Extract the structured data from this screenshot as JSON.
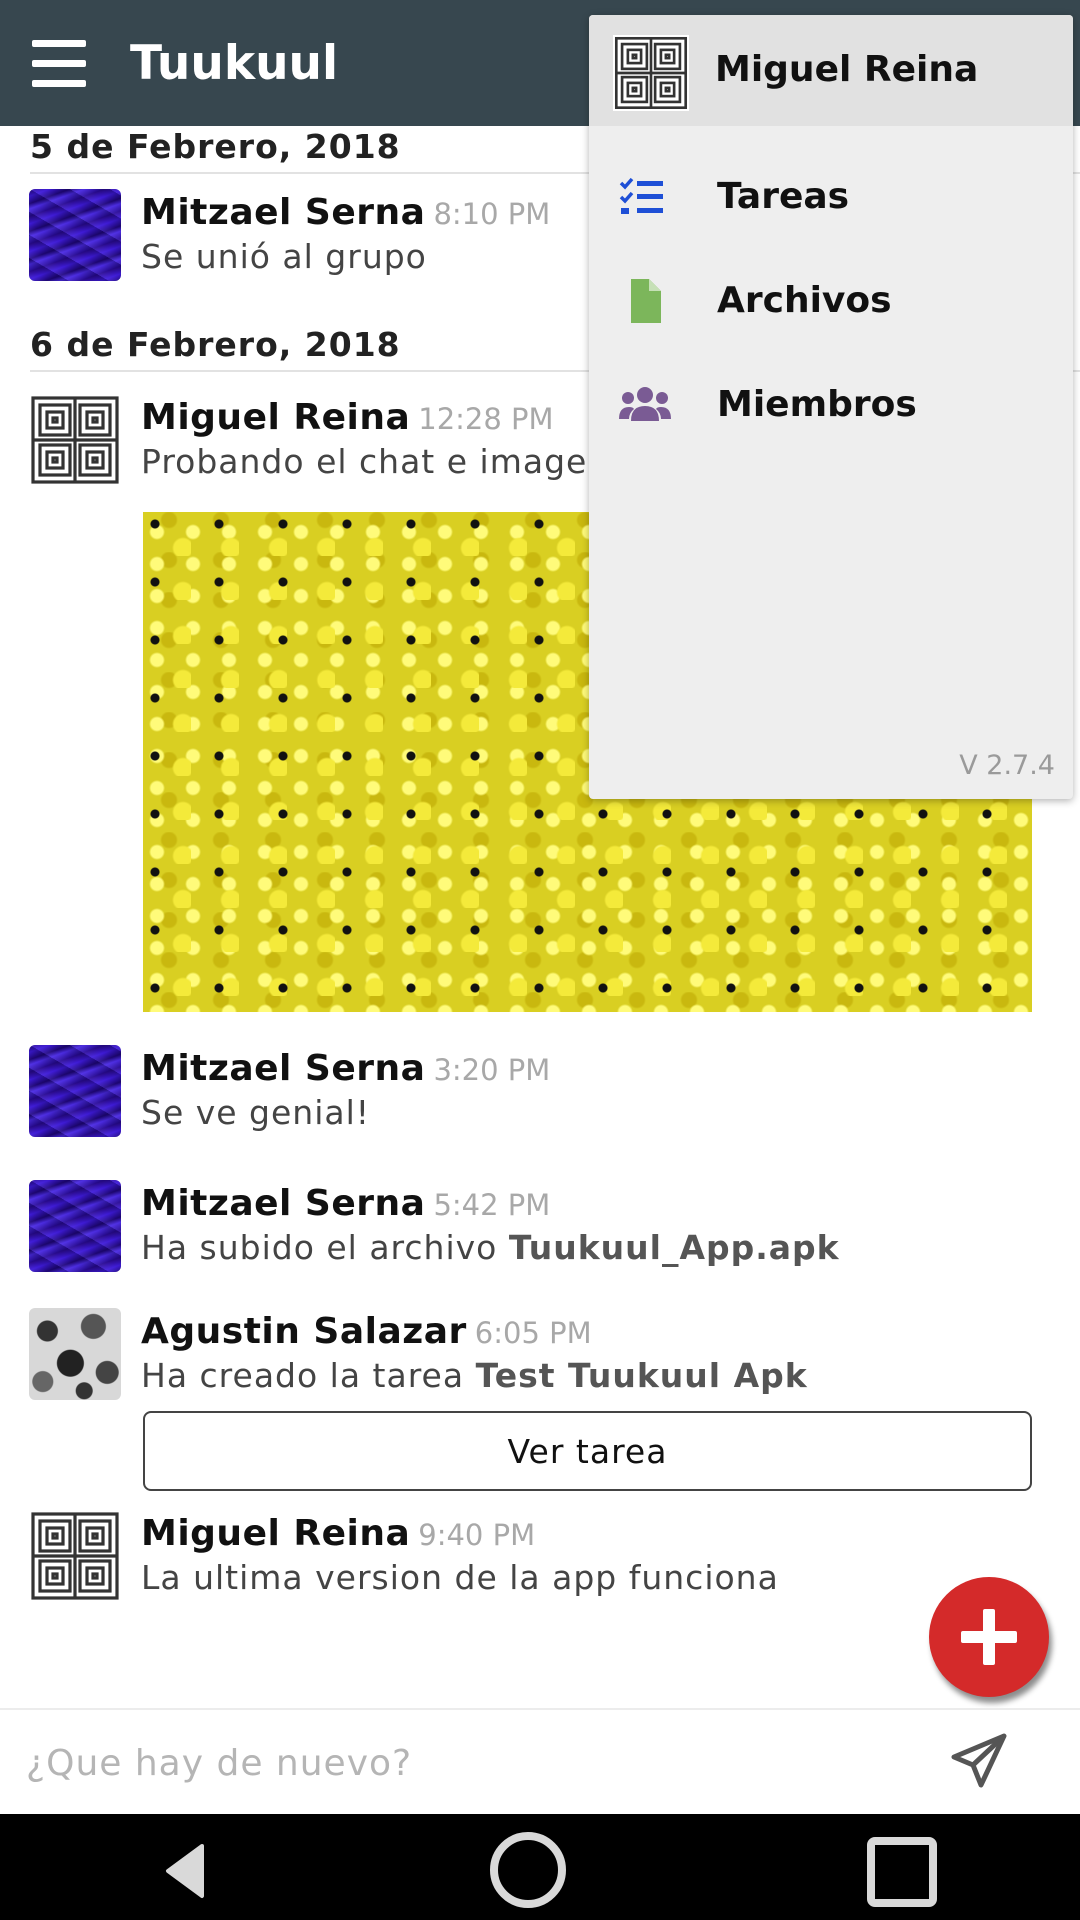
{
  "app": {
    "title": "Tuukuul"
  },
  "chat": {
    "dates": [
      "5 de Febrero, 2018",
      "6 de Febrero, 2018"
    ],
    "messages": [
      {
        "name": "Mitzael Serna",
        "time": "8:10 PM",
        "text": "Se unió al grupo"
      },
      {
        "name": "Miguel Reina",
        "time": "12:28 PM",
        "text": "Probando el chat e imagenes"
      },
      {
        "name": "Mitzael Serna",
        "time": "3:20 PM",
        "text": "Se ve genial!"
      },
      {
        "name": "Mitzael Serna",
        "time": "5:42 PM",
        "text": "Ha subido el archivo ",
        "bold": "Tuukuul_App.apk"
      },
      {
        "name": "Agustin Salazar",
        "time": "6:05 PM",
        "text": "Ha creado la tarea ",
        "bold": "Test Tuukuul Apk"
      },
      {
        "name": "Miguel Reina",
        "time": "9:40 PM",
        "text": "La ultima version de la app funciona"
      }
    ],
    "task_button": "Ver tarea"
  },
  "composer": {
    "placeholder": "¿Que hay de nuevo?"
  },
  "menu": {
    "user": "Miguel Reina",
    "items": [
      {
        "label": "Tareas",
        "icon": "task-list-icon",
        "color": "#1e4fd6"
      },
      {
        "label": "Archivos",
        "icon": "file-icon",
        "color": "#7cb65b"
      },
      {
        "label": "Miembros",
        "icon": "users-icon",
        "color": "#7a5b94"
      }
    ],
    "version": "V 2.7.4"
  },
  "colors": {
    "appbar": "#37474f",
    "fab": "#d42a2a",
    "menu_bg": "#eeeeee"
  }
}
